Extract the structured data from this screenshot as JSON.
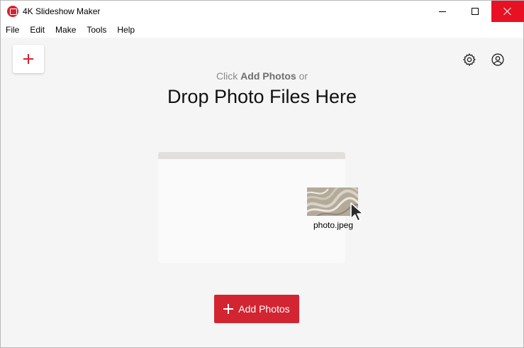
{
  "window": {
    "title": "4K Slideshow Maker",
    "accent": "#d32432",
    "close_hover_color": "#e81123",
    "controls": [
      "minimize-icon",
      "maximize-icon",
      "close-icon"
    ]
  },
  "menu": {
    "items": [
      "File",
      "Edit",
      "Make",
      "Tools",
      "Help"
    ]
  },
  "toolbar": {
    "add_icon": "plus-icon",
    "settings_icon": "gear-icon",
    "account_icon": "account-icon"
  },
  "drop_zone": {
    "hint_prefix": "Click",
    "hint_bold": "Add Photos",
    "hint_suffix": "or",
    "headline": "Drop Photo Files Here",
    "file_name": "photo.jpeg",
    "cursor_icon": "arrow-cursor-icon"
  },
  "add_button": {
    "label": "Add Photos",
    "icon": "plus-icon"
  }
}
